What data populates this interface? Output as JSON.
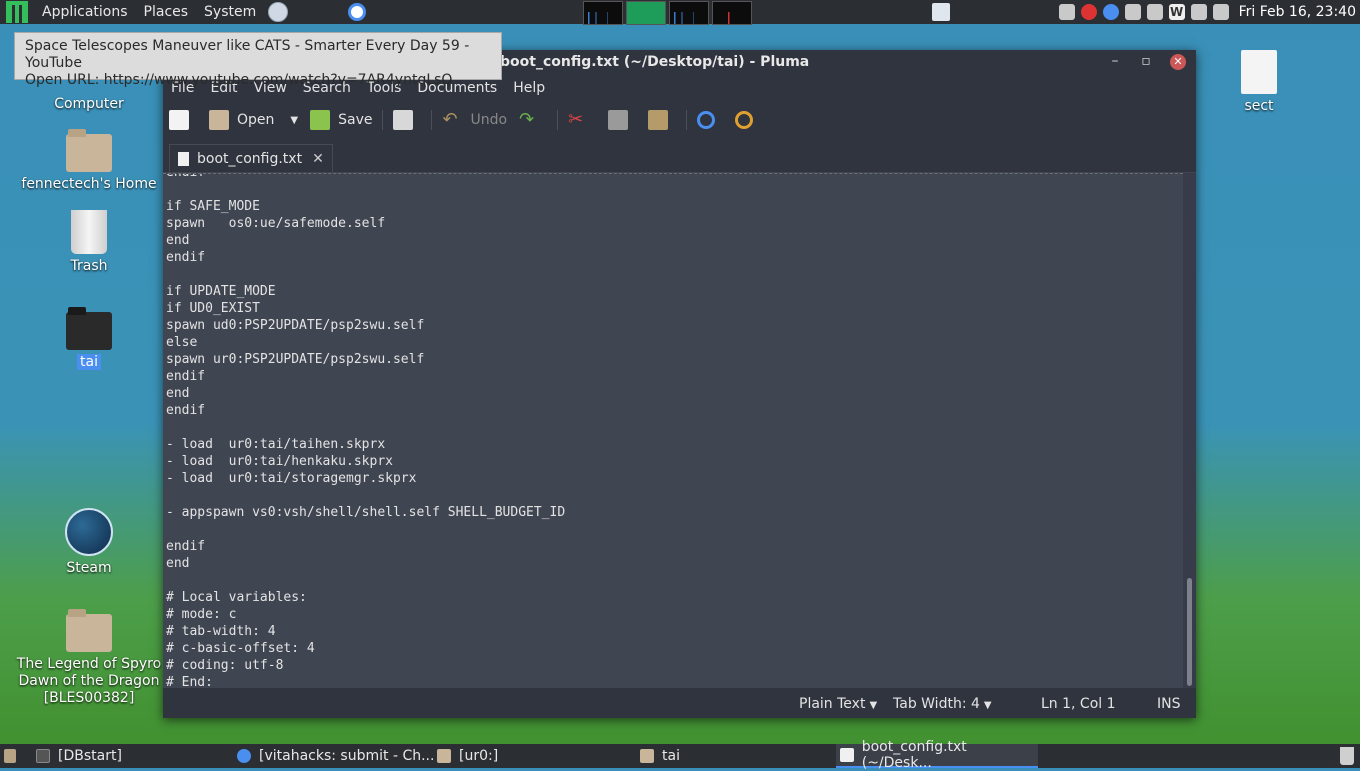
{
  "top_panel": {
    "menus": [
      "Applications",
      "Places",
      "System"
    ],
    "clock": "Fri Feb 16, 23:40"
  },
  "tooltip": {
    "title": "Space Telescopes Maneuver like CATS - Smarter Every Day 59 - YouTube",
    "url": "Open URL: https://www.youtube.com/watch?v=7AR4yntqLsQ"
  },
  "desktop": {
    "icons": [
      "Computer",
      "fennectech's Home",
      "Trash",
      "tai",
      "Steam",
      "The Legend of Spyro Dawn of the Dragon [BLES00382]",
      "sect"
    ]
  },
  "window": {
    "title": "boot_config.txt (~/Desktop/tai) - Pluma",
    "menu": [
      "File",
      "Edit",
      "View",
      "Search",
      "Tools",
      "Documents",
      "Help"
    ],
    "toolbar": {
      "open": "Open",
      "save": "Save",
      "undo": "Undo"
    },
    "tab": "boot_config.txt",
    "code": "endif\n\nif SAFE_MODE\nspawn   os0:ue/safemode.self\nend\nendif\n\nif UPDATE_MODE\nif UD0_EXIST\nspawn ud0:PSP2UPDATE/psp2swu.self\nelse\nspawn ur0:PSP2UPDATE/psp2swu.self\nendif\nend\nendif\n\n- load  ur0:tai/taihen.skprx\n- load  ur0:tai/henkaku.skprx\n- load  ur0:tai/storagemgr.skprx\n\n- appspawn vs0:vsh/shell/shell.self SHELL_BUDGET_ID\n\nendif\nend\n\n# Local variables:\n# mode: c\n# tab-width: 4\n# c-basic-offset: 4\n# coding: utf-8\n# End:",
    "status": {
      "language": "Plain Text",
      "tab_width": "Tab Width:  4",
      "position": "Ln 1, Col 1",
      "mode": "INS"
    }
  },
  "taskbar": {
    "tasks": [
      "[DBstart]",
      "[vitahacks: submit - Ch...",
      "[ur0:]",
      "tai",
      "boot_config.txt (~/Desk..."
    ]
  }
}
